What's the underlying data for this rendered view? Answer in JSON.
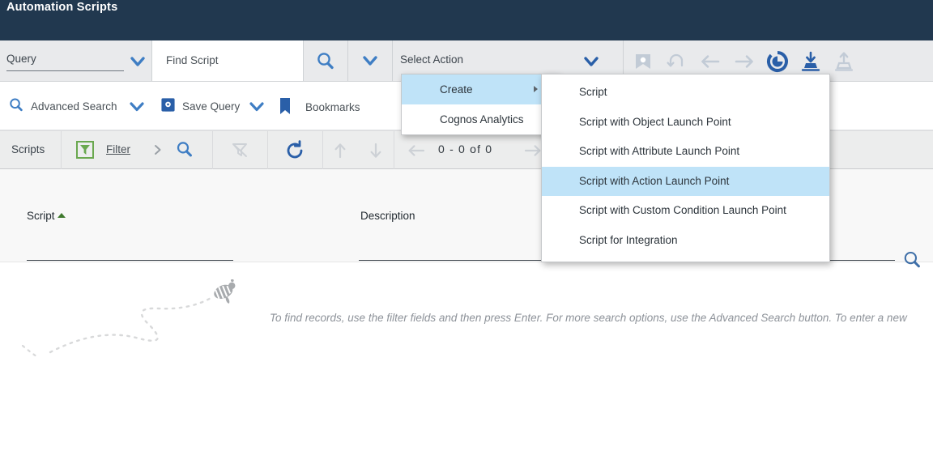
{
  "header": {
    "title": "Automation Scripts"
  },
  "toolbar_query": {
    "query_label": "Query",
    "query_caret_icon": "chevron-down-icon",
    "find_value": "Find Script",
    "find_go_icon": "search-icon",
    "find_caret_icon": "chevron-down-icon",
    "select_action_label": "Select Action",
    "select_action_caret_icon": "chevron-down-icon",
    "icons": [
      {
        "name": "insert-record-icon",
        "enabled": false
      },
      {
        "name": "undo-icon",
        "enabled": false
      },
      {
        "name": "previous-record-icon",
        "enabled": false
      },
      {
        "name": "next-record-icon",
        "enabled": false
      },
      {
        "name": "change-status-icon",
        "enabled": true
      },
      {
        "name": "download-icon",
        "enabled": true
      },
      {
        "name": "upload-icon",
        "enabled": false
      }
    ]
  },
  "toolbar_search": {
    "advanced_search_label": "Advanced Search",
    "advanced_search_icon": "search-icon",
    "advanced_search_caret_icon": "chevron-down-icon",
    "save_query_label": "Save Query",
    "save_query_icon": "save-query-icon",
    "save_query_caret_icon": "chevron-down-icon",
    "bookmarks_label": "Bookmarks",
    "bookmarks_icon": "bookmark-icon"
  },
  "list_toolbar": {
    "tab_label": "Scripts",
    "filter_icon": "filter-icon",
    "filter_label": "Filter",
    "filter_next_icon": "chevron-right-icon",
    "filter_search_icon": "search-icon",
    "clear_filter_icon": "clear-filter-icon",
    "refresh_icon": "refresh-icon",
    "sort_up_icon": "arrow-up-icon",
    "sort_down_icon": "arrow-down-icon",
    "prev_page_icon": "arrow-left-icon",
    "next_page_icon": "arrow-right-icon",
    "pager_text": "0 - 0 of 0"
  },
  "table": {
    "columns": [
      {
        "label": "Script",
        "sorted": "asc"
      },
      {
        "label": "Description",
        "sorted": "none"
      },
      {
        "label": "",
        "sorted": "none"
      }
    ],
    "row_search_icon": "search-icon",
    "rows": []
  },
  "empty_state": {
    "message": "To find records, use the filter fields and then press Enter. For more search options, use the Advanced Search button. To enter a new ",
    "illustration": "bee-with-dotted-trail"
  },
  "action_menu": {
    "items": [
      {
        "label": "Create",
        "selected": true,
        "has_submenu": true
      },
      {
        "label": "Cognos Analytics",
        "selected": false,
        "has_submenu": false
      }
    ]
  },
  "create_submenu": {
    "items": [
      {
        "label": "Script",
        "selected": false
      },
      {
        "label": "Script with Object Launch Point",
        "selected": false
      },
      {
        "label": "Script with Attribute Launch Point",
        "selected": false
      },
      {
        "label": "Script with Action Launch Point",
        "selected": true
      },
      {
        "label": "Script with Custom Condition Launch Point",
        "selected": false
      },
      {
        "label": "Script for Integration",
        "selected": false
      }
    ]
  },
  "colors": {
    "header_bg": "#21384f",
    "accent_blue": "#3f7ec4",
    "dark_blue": "#2a5fa8",
    "menu_highlight": "#bfe3f8",
    "sort_green": "#3f7a2e",
    "disabled_gray": "#c2cbd6"
  }
}
